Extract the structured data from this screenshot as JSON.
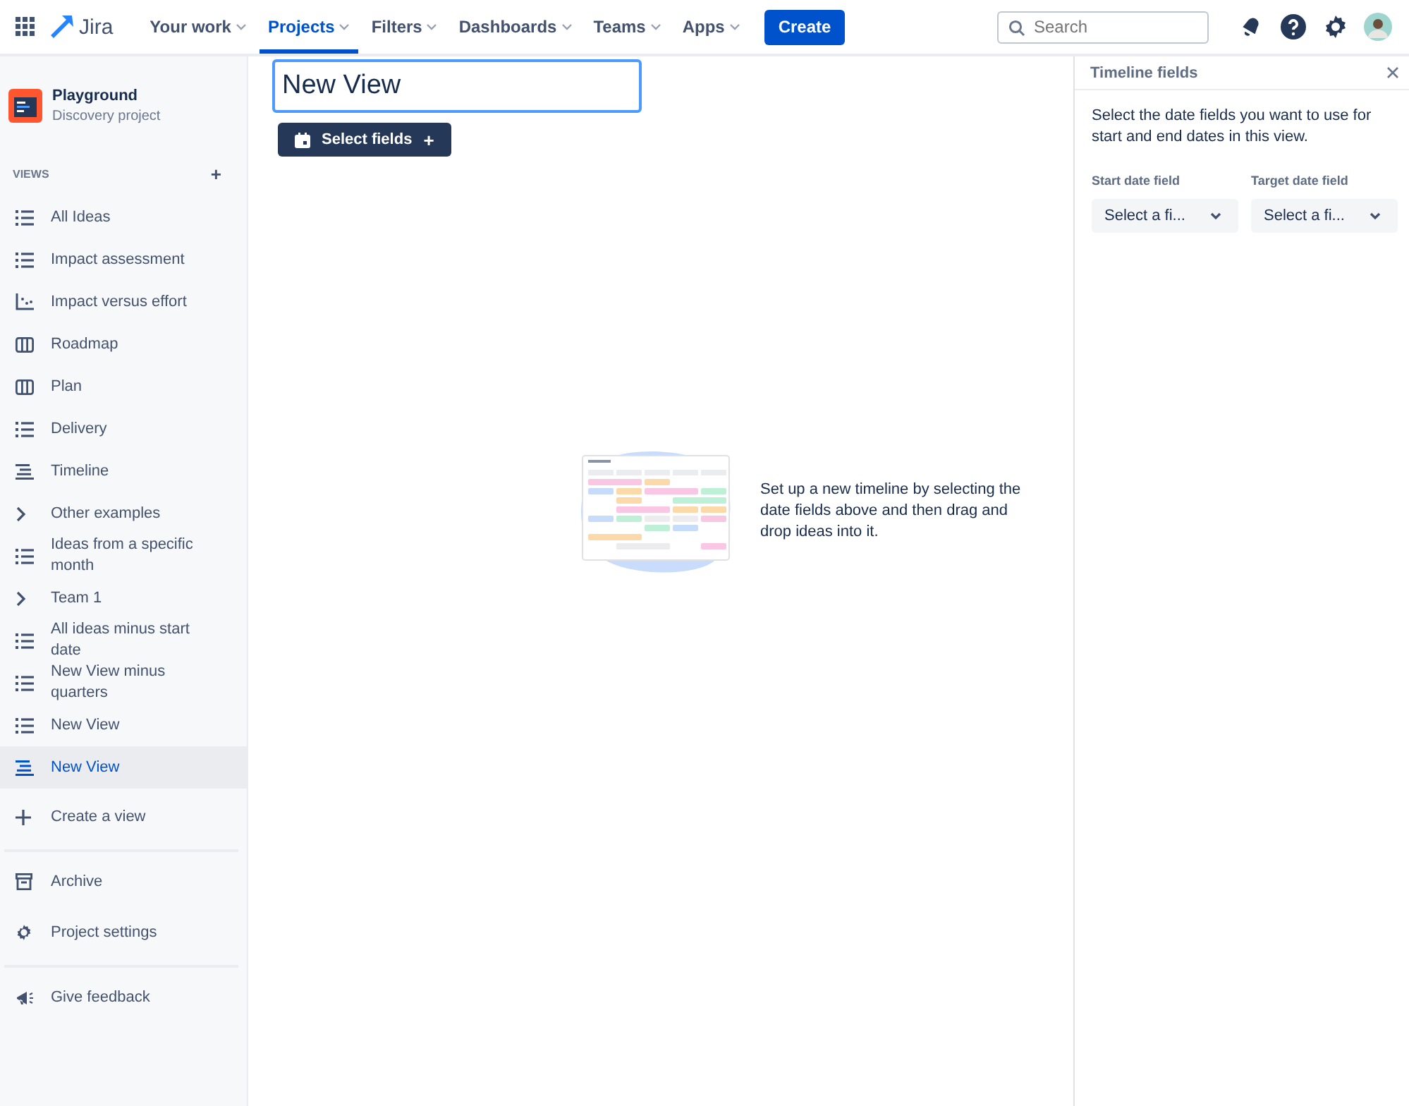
{
  "topbar": {
    "product": "Jira",
    "nav": [
      {
        "label": "Your work",
        "selected": false
      },
      {
        "label": "Projects",
        "selected": true
      },
      {
        "label": "Filters",
        "selected": false
      },
      {
        "label": "Dashboards",
        "selected": false
      },
      {
        "label": "Teams",
        "selected": false
      },
      {
        "label": "Apps",
        "selected": false
      }
    ],
    "create": "Create",
    "search": {
      "placeholder": "Search"
    }
  },
  "project": {
    "name": "Playground",
    "type": "Discovery project"
  },
  "views_heading": "VIEWS",
  "views_add": "+",
  "views": [
    {
      "label": "All Ideas",
      "kind": "list",
      "selected": false
    },
    {
      "label": "Impact assessment",
      "kind": "list",
      "selected": false
    },
    {
      "label": "Impact versus effort",
      "kind": "matrix",
      "selected": false
    },
    {
      "label": "Roadmap",
      "kind": "board",
      "selected": false
    },
    {
      "label": "Plan",
      "kind": "board",
      "selected": false
    },
    {
      "label": "Delivery",
      "kind": "list",
      "selected": false
    },
    {
      "label": "Timeline",
      "kind": "timeline",
      "selected": false
    },
    {
      "label": "Other examples",
      "kind": "folder",
      "selected": false
    },
    {
      "label": "Ideas from a specific month",
      "kind": "list",
      "selected": false
    },
    {
      "label": "Team 1",
      "kind": "folder",
      "selected": false
    },
    {
      "label": "All ideas minus start date",
      "kind": "list",
      "selected": false
    },
    {
      "label": "New View minus quarters",
      "kind": "list",
      "selected": false
    },
    {
      "label": "New View",
      "kind": "list",
      "selected": false
    },
    {
      "label": "New View",
      "kind": "timeline",
      "selected": true
    }
  ],
  "create_view": "Create a view",
  "footer_links": [
    {
      "label": "Archive",
      "kind": "archive"
    },
    {
      "label": "Project settings",
      "kind": "settings"
    },
    {
      "label": "Give feedback",
      "kind": "feedback"
    }
  ],
  "main": {
    "view_name": "New View",
    "select_fields": "Select fields",
    "select_fields_plus": "+",
    "empty_state": "Set up a new timeline by selecting the date fields above and then drag and drop ideas into it."
  },
  "panel": {
    "title": "Timeline fields",
    "description": "Select the date fields you want to use for start and end dates in this view.",
    "fields": [
      {
        "label": "Start date field",
        "value": "Select a fi..."
      },
      {
        "label": "Target date field",
        "value": "Select a fi..."
      }
    ]
  }
}
